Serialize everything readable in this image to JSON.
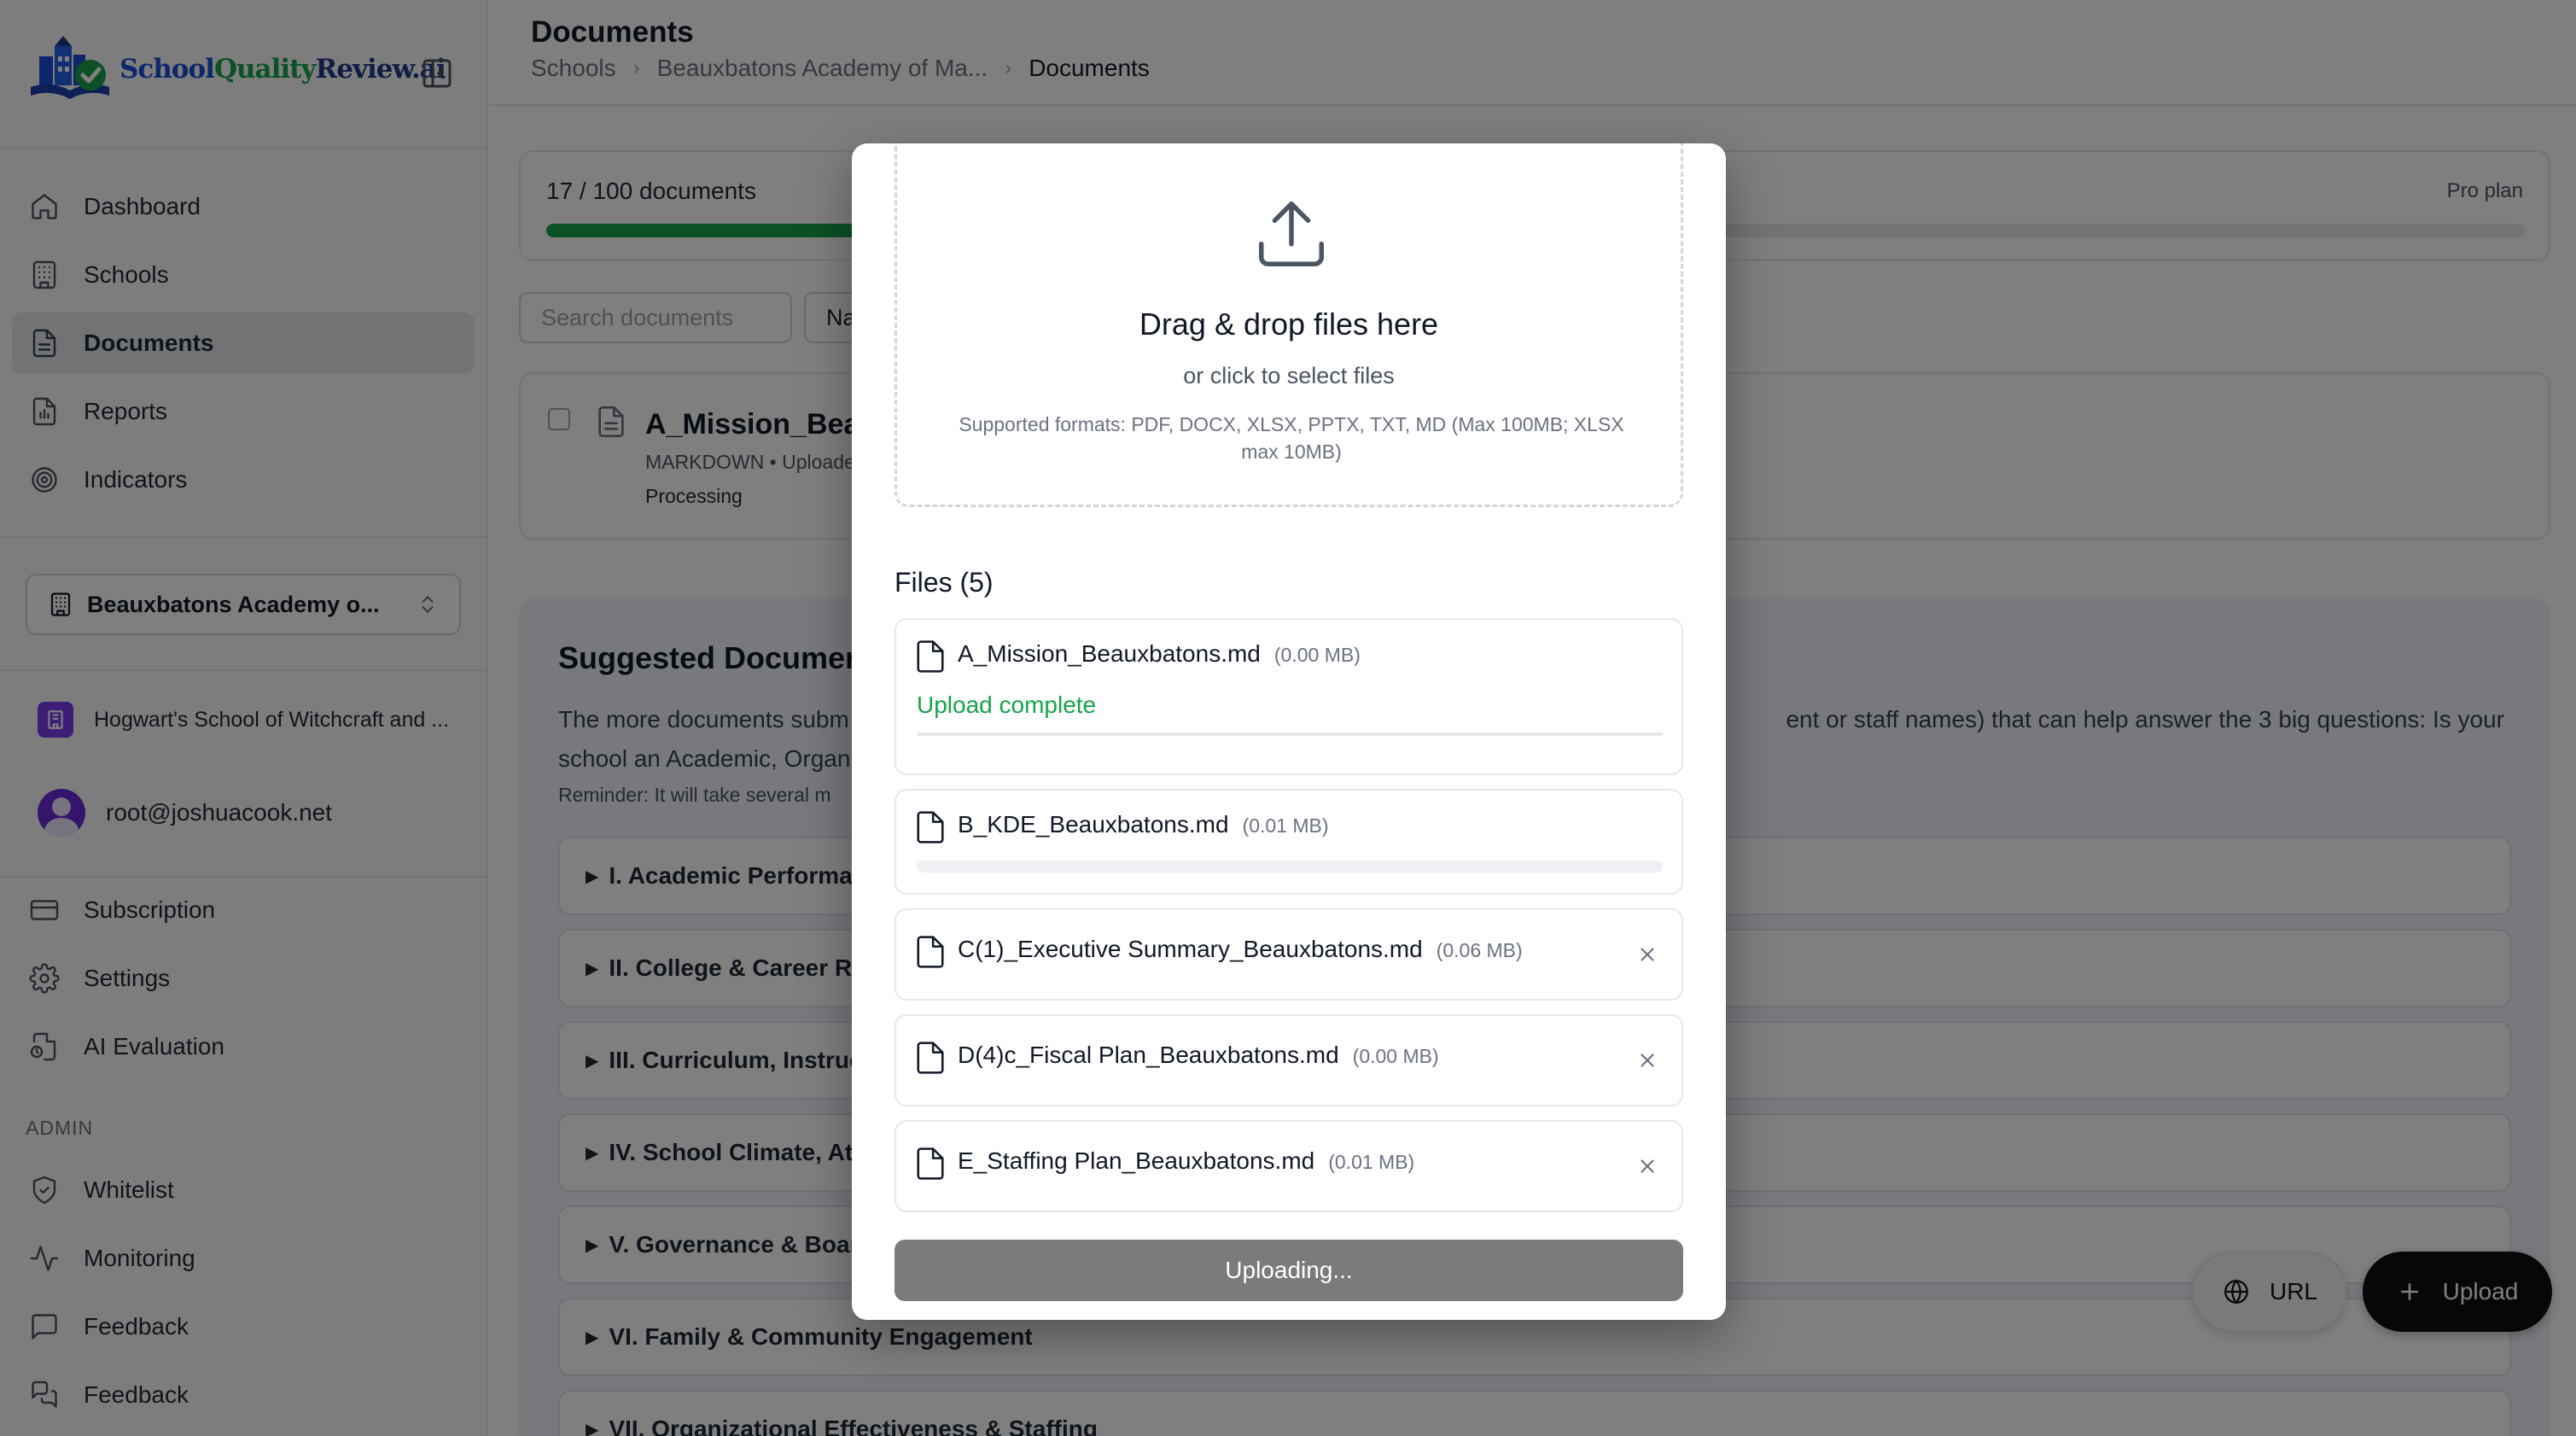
{
  "brand": {
    "name_part1": "School",
    "name_part2": "Quality",
    "name_part3": "Review.ai"
  },
  "sidebar": {
    "nav": [
      {
        "label": "Dashboard",
        "icon": "home-icon"
      },
      {
        "label": "Schools",
        "icon": "building-icon"
      },
      {
        "label": "Documents",
        "icon": "document-icon",
        "active": true
      },
      {
        "label": "Reports",
        "icon": "report-icon"
      },
      {
        "label": "Indicators",
        "icon": "target-icon"
      }
    ],
    "school_selector": "Beauxbatons Academy o...",
    "organization": "Hogwart's School of Witchcraft and ...",
    "user_email": "root@joshuacook.net",
    "account_nav": [
      {
        "label": "Subscription",
        "icon": "credit-card-icon"
      },
      {
        "label": "Settings",
        "icon": "gear-icon"
      },
      {
        "label": "AI Evaluation",
        "icon": "ai-evaluation-icon"
      }
    ],
    "admin_label": "ADMIN",
    "admin_nav": [
      {
        "label": "Whitelist",
        "icon": "shield-check-icon"
      },
      {
        "label": "Monitoring",
        "icon": "activity-icon"
      },
      {
        "label": "Feedback",
        "icon": "message-icon"
      },
      {
        "label": "Feedback",
        "icon": "messages-icon"
      }
    ]
  },
  "header": {
    "title": "Documents",
    "breadcrumb": [
      "Schools",
      "Beauxbatons Academy of Ma...",
      "Documents"
    ]
  },
  "usage": {
    "text": "17 / 100 documents",
    "plan": "Pro plan",
    "used": 17,
    "limit": 100
  },
  "toolbar": {
    "search_placeholder": "Search documents",
    "sort_label": "Na"
  },
  "document": {
    "name": "A_Mission_Bea",
    "meta": "MARKDOWN • Uploade",
    "status": "Processing"
  },
  "suggested": {
    "title": "Suggested Documen",
    "desc_line1_left": "The more documents subm",
    "desc_line1_right": "ent or staff names) that can help answer the 3 big questions: Is your",
    "desc_line2": "school an Academic, Organ",
    "reminder": "Reminder: It will take several m",
    "sections": [
      "I. Academic Performa",
      "II. College & Career Re",
      "III. Curriculum, Instruc",
      "IV. School Climate, At",
      "V. Governance & Boar",
      "VI. Family & Community Engagement",
      "VII. Organizational Effectiveness & Staffing"
    ]
  },
  "fab": {
    "url_label": "URL",
    "upload_label": "Upload"
  },
  "modal": {
    "dropzone_title": "Drag & drop files here",
    "dropzone_subtitle": "or click to select files",
    "dropzone_formats": "Supported formats: PDF, DOCX, XLSX, PPTX, TXT, MD (Max 100MB; XLSX max 10MB)",
    "files_heading": "Files (5)",
    "files": [
      {
        "name": "A_Mission_Beauxbatons.md",
        "size": "(0.00 MB)",
        "status": "Upload complete",
        "progress": 1.0
      },
      {
        "name": "B_KDE_Beauxbatons.md",
        "size": "(0.01 MB)",
        "progress": 0.0
      },
      {
        "name": "C(1)_Executive Summary_Beauxbatons.md",
        "size": "(0.06 MB)"
      },
      {
        "name": "D(4)c_Fiscal Plan_Beauxbatons.md",
        "size": "(0.00 MB)"
      },
      {
        "name": "E_Staffing Plan_Beauxbatons.md",
        "size": "(0.01 MB)"
      }
    ],
    "submit_label": "Uploading..."
  },
  "colors": {
    "accent_green": "#16a34a",
    "org_badge": "#7c3aed",
    "overlay": "rgba(0,0,0,0.5)"
  }
}
